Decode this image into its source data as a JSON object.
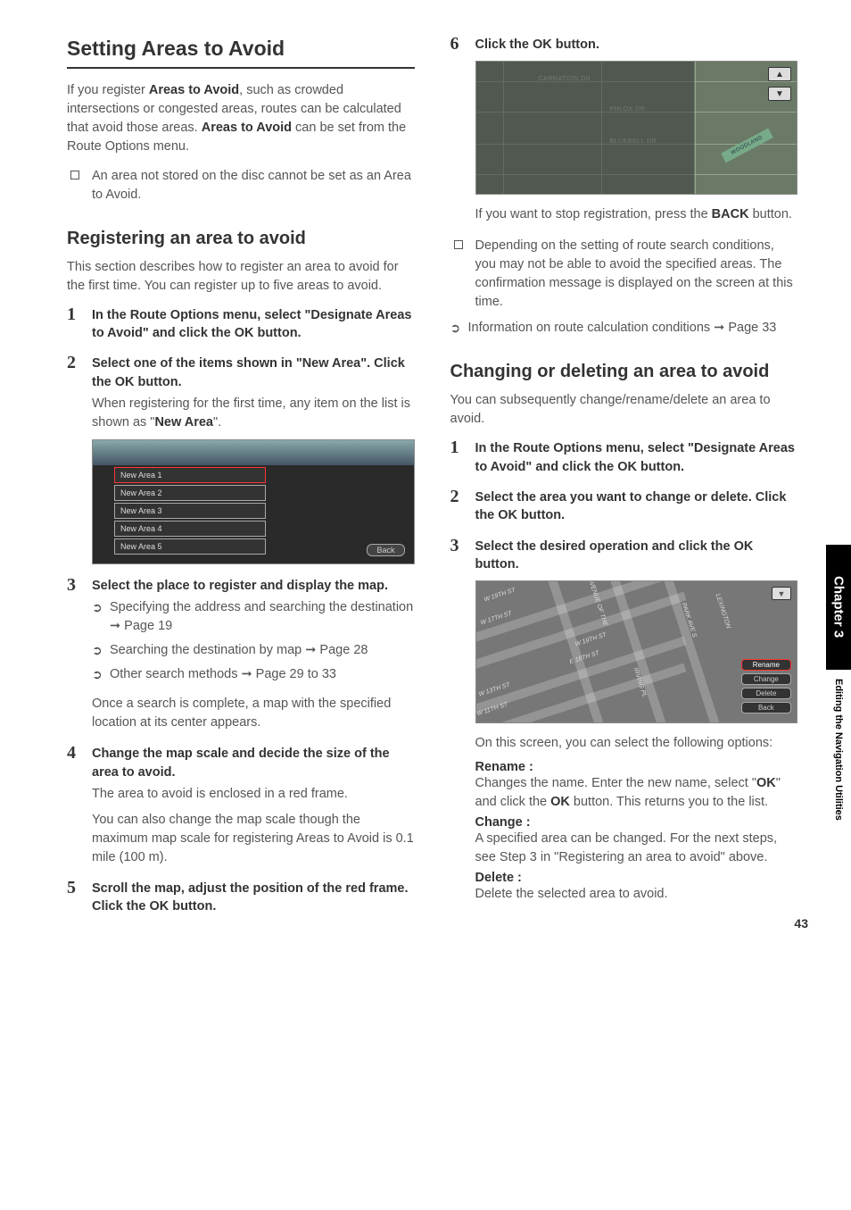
{
  "sideTab": {
    "chapter": "Chapter 3",
    "title": "Editing the Navigation Utilities"
  },
  "pageNumber": "43",
  "left": {
    "h1": "Setting Areas to Avoid",
    "intro_parts": {
      "p1a": "If you register ",
      "b1": "Areas to Avoid",
      "p1b": ", such as crowded intersections or congested areas, routes can be calculated that avoid those areas. ",
      "b2": "Areas to Avoid",
      "p1c": " can be set from the Route Options menu."
    },
    "note1": "An area not stored on the disc cannot be set as an Area to Avoid.",
    "h2": "Registering an area to avoid",
    "p2": "This section describes how to register an area to avoid for the first time. You can register up to five areas to avoid.",
    "steps": [
      {
        "head_parts": [
          "In the Route Options menu, select \"Designate Areas to Avoid\" and click the ",
          "OK",
          " button."
        ]
      },
      {
        "head_parts": [
          "Select one of the items shown in \"New Area\". Click the ",
          "OK",
          " button."
        ],
        "body_parts": [
          "When registering for the first time, any item on the list is shown as \"",
          "New Area",
          "\"."
        ],
        "shot_items": [
          "New Area 1",
          "New Area 2",
          "New Area 3",
          "New Area 4",
          "New Area 5"
        ],
        "shot_back": "Back"
      },
      {
        "head": "Select the place to register and display the map.",
        "refs": [
          "Specifying the address and searching the destination ➞ Page 19",
          "Searching the destination by map ➞ Page 28",
          "Other search methods ➞ Page 29 to 33"
        ],
        "body2": "Once a search is complete, a map with the specified location at its center appears."
      },
      {
        "head": "Change the map scale and decide the size of the area to avoid.",
        "body": "The area to avoid is enclosed in a red frame.",
        "body2": "You can also change the map scale though the maximum map scale for registering Areas to Avoid is 0.1 mile (100 m)."
      },
      {
        "head_parts": [
          "Scroll the map, adjust the position of the red frame.  Click the ",
          "OK",
          " button."
        ]
      }
    ]
  },
  "right": {
    "step6": {
      "num": "6",
      "head_parts": [
        "Click the ",
        "OK",
        " button."
      ],
      "map_labels": {
        "carnation": "CARNATION DR",
        "phlox": "PHLOX DR",
        "bluebell": "BLUEBELL DR",
        "woodland": "WOODLAND"
      },
      "scale_up": "▲",
      "scale_dn": "▼",
      "after_parts": [
        "If you want to stop registration, press the ",
        "BACK",
        " button."
      ]
    },
    "note": "Depending on the setting of route search conditions, you may not be able to avoid the specified areas. The confirmation message is displayed on the screen at this time.",
    "ref": "Information on route calculation conditions ➞ Page 33",
    "h2": "Changing or deleting an area to avoid",
    "p1": "You can subsequently change/rename/delete an area to avoid.",
    "steps": [
      {
        "head_parts": [
          "In the Route Options menu, select \"Designate Areas to Avoid\" and click the ",
          "OK",
          " button."
        ]
      },
      {
        "head_parts": [
          "Select the area you want to change or delete. Click the ",
          "OK",
          " button."
        ]
      },
      {
        "head_parts": [
          "Select the desired operation and click the ",
          "OK",
          " button."
        ],
        "map_buttons": [
          "Rename",
          "Change",
          "Delete",
          "Back"
        ],
        "streets": [
          "W 19TH ST",
          "W 17TH ST",
          "W 19TH ST",
          "E 18TH ST",
          "W 13TH ST",
          "W 11TH ST",
          "AVENUE OF THE",
          "IRVING PL",
          "PARK AVE S",
          "LEXINGTON"
        ],
        "after": "On this screen, you can select the following options:",
        "options": [
          {
            "label": "Rename :",
            "body_parts": [
              "Changes the name. Enter the new name, select \"",
              "OK",
              "\" and click the ",
              "OK",
              " button. This returns you to the list."
            ]
          },
          {
            "label": "Change :",
            "body": "A specified area can be changed. For the next steps, see Step 3 in \"Registering an area to avoid\" above."
          },
          {
            "label": "Delete :",
            "body": "Delete the selected area to avoid."
          }
        ]
      }
    ]
  }
}
